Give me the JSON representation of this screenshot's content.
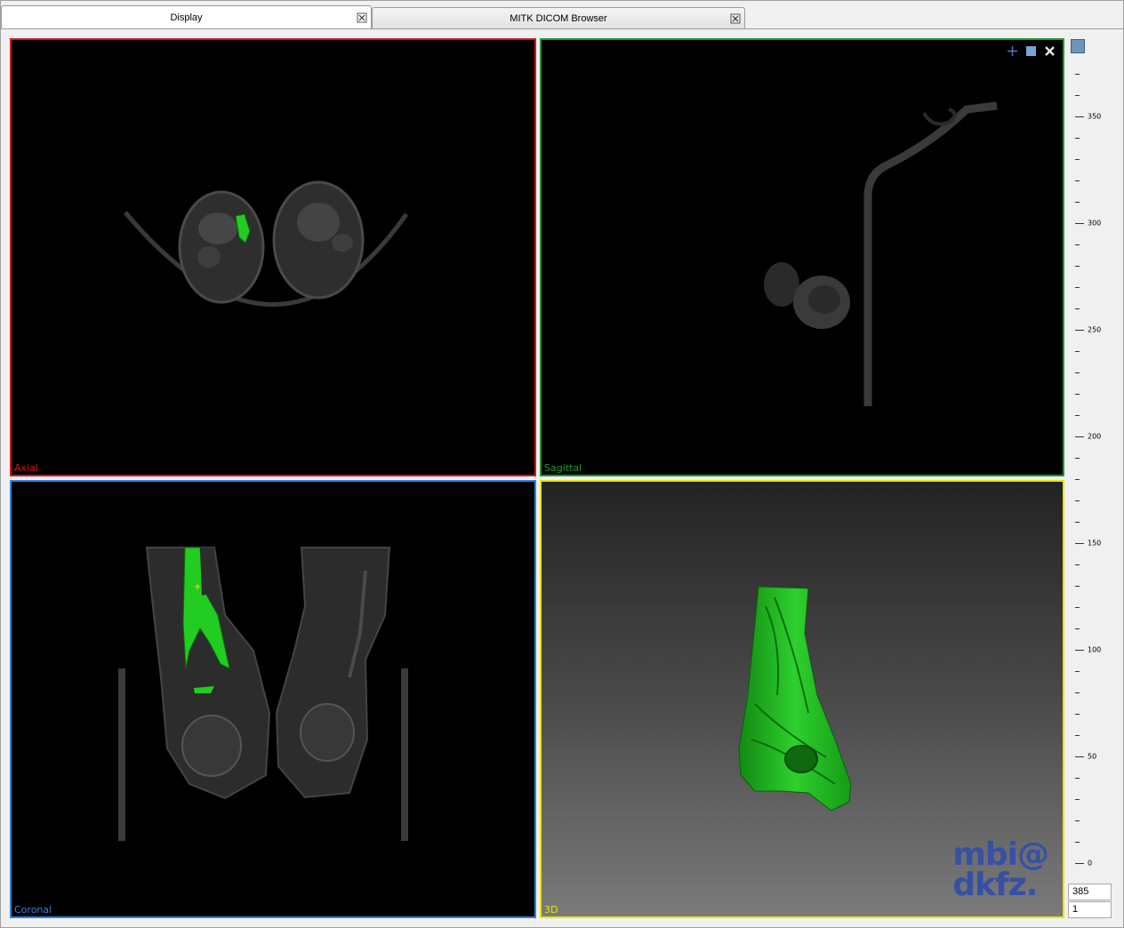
{
  "tabs": [
    {
      "label": "Display",
      "active": true
    },
    {
      "label": "MITK DICOM Browser",
      "active": false
    }
  ],
  "viewports": {
    "axial": {
      "label": "Axial",
      "color": "#d4171e"
    },
    "sagittal": {
      "label": "Sagittal",
      "color": "#1a9f2d"
    },
    "coronal": {
      "label": "Coronal",
      "color": "#2a86e8"
    },
    "three_d": {
      "label": "3D",
      "color": "#e8e500"
    }
  },
  "viewport_tools": [
    "plus-icon",
    "maximize-square-icon",
    "tools-cross-icon"
  ],
  "logo": {
    "line1": "mbi@",
    "line2": "dkfz."
  },
  "slice_slider": {
    "tick_labels": [
      "350",
      "300",
      "250",
      "200",
      "150",
      "100",
      "50",
      "0"
    ],
    "value": "385",
    "step": "1"
  },
  "segmentation_color": "#22cc22"
}
